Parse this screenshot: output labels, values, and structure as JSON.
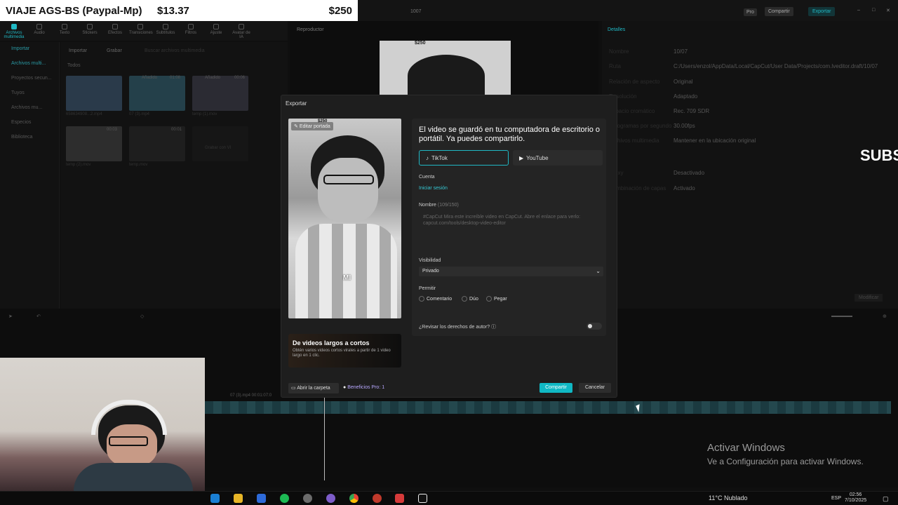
{
  "donation_bar": {
    "title": "VIAJE AGS-BS (Paypal-Mp)",
    "amount": "$13.37",
    "goal": "$250"
  },
  "window": {
    "frame_counter": "1007",
    "pro_label": "Pro",
    "share_label": "Compartir",
    "export_label": "Exportar"
  },
  "toolbar": {
    "items": [
      "Archivos multimedia",
      "Audio",
      "Texto",
      "Stickers",
      "Efectos",
      "Transiciones",
      "Subtítulos",
      "Filtros",
      "Ajuste",
      "Avatar de IA"
    ]
  },
  "left_nav": {
    "items": [
      "Importar",
      "Archivos multi...",
      "Proyectos secun...",
      "Tuyos",
      "Archivos mu...",
      "Especios",
      "Biblioteca"
    ]
  },
  "media": {
    "import_label": "Importar",
    "record_label": "Grabar",
    "search_placeholder": "Buscar archivos multimedia",
    "all_label": "Todos",
    "thumbs": [
      {
        "tag": "",
        "duration": "",
        "name": "658634908...2.mp4"
      },
      {
        "tag": "Añadido",
        "duration": "01:08",
        "name": "07 (3).mp4"
      },
      {
        "tag": "Añadido",
        "duration": "00:06",
        "name": "temp (1).mov"
      },
      {
        "tag": "",
        "duration": "00:03",
        "name": "temp (2).mov"
      },
      {
        "tag": "",
        "duration": "00:01",
        "name": "temp.mov"
      },
      {
        "tag": "",
        "duration": "",
        "name": "Grabar con VI"
      }
    ]
  },
  "player": {
    "title": "Reproductor",
    "price_tag": "$250"
  },
  "details": {
    "title": "Detalles",
    "modify_label": "Modificar",
    "rows": [
      {
        "k": "Nombre",
        "v": "10/07"
      },
      {
        "k": "Ruta",
        "v": "C:/Users/enzol/AppData/Local/CapCut/User Data/Projects/com.lveditor.draft/10/07"
      },
      {
        "k": "Relación de aspecto",
        "v": "Original"
      },
      {
        "k": "Resolución",
        "v": "Adaptado"
      },
      {
        "k": "Espacio cromático",
        "v": "Rec. 709 SDR"
      },
      {
        "k": "Fotogramas por segundo",
        "v": "30.00fps"
      },
      {
        "k": "Archivos multimedia",
        "v": "Mantener en la ubicación original"
      },
      {
        "k": "Proxy",
        "v": "Desactivado"
      },
      {
        "k": "Combinación de capas",
        "v": "Activado"
      }
    ]
  },
  "overlay_text": {
    "subs": "SUBS"
  },
  "dialog": {
    "title": "Exportar",
    "cover_edit": "Editar portada",
    "cover_price": "$250",
    "cover_caption": "MI",
    "promo_title": "De videos largos a cortos",
    "promo_sub": "Obtén varios videos cortos virales a partir de 1 video largo en 1 clic.",
    "message": "El video se guardó en tu computadora de escritorio o portátil. Ya puedes compartirlo.",
    "tiktok": "TikTok",
    "youtube": "YouTube",
    "account_label": "Cuenta",
    "login_label": "Iniciar sesión",
    "name_label": "Nombre",
    "name_count": "(109/150)",
    "name_text": "#CapCut Mira este increíble video en CapCut. Abre el enlace para verlo: capcut.com/tools/desktop-video-editor",
    "visibility_label": "Visibilidad",
    "visibility_value": "Privado",
    "allow_label": "Permitir",
    "allow_options": [
      "Comentario",
      "Dúo",
      "Pegar"
    ],
    "copyright_label": "¿Revisar los derechos de autor?",
    "folder_button": "Abrir la carpeta",
    "benefits": "Beneficios Pro: 1",
    "share_button": "Compartir",
    "cancel_button": "Cancelar"
  },
  "timeline": {
    "clip_label": "07 (3).mp4  00:01:07:0"
  },
  "windows_activation": {
    "line1": "Activar Windows",
    "line2": "Ve a Configuración para activar Windows."
  },
  "taskbar": {
    "weather": "11°C  Nublado",
    "lang": "ESP",
    "time": "02:56",
    "date": "7/10/2025",
    "icons": [
      "edge-icon",
      "files-icon",
      "store-icon",
      "spotify-icon",
      "settings-icon",
      "obs-icon",
      "chrome-icon",
      "app-icon",
      "capcut-alt-icon",
      "capcut-icon"
    ]
  }
}
